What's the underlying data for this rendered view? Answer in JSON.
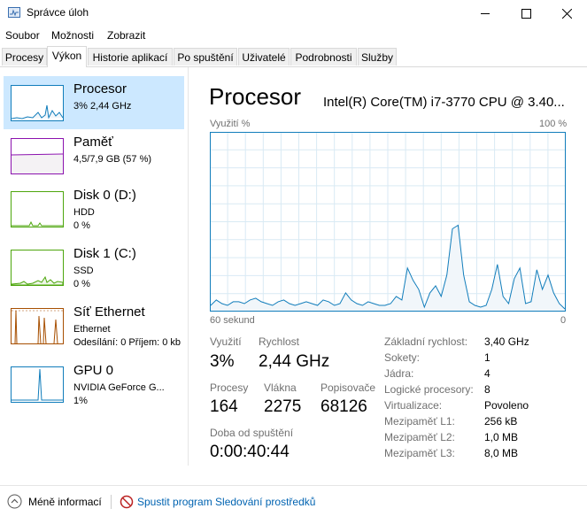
{
  "window": {
    "title": "Správce úloh"
  },
  "menu": {
    "items": [
      "Soubor",
      "Možnosti",
      "Zobrazit"
    ]
  },
  "tabs": [
    "Procesy",
    "Výkon",
    "Historie aplikací",
    "Po spuštění",
    "Uživatelé",
    "Podrobnosti",
    "Služby"
  ],
  "active_tab": "Výkon",
  "sidebar": {
    "items": [
      {
        "title": "Procesor",
        "line1": "3% 2,44 GHz",
        "line2": "",
        "color": "#117dbb"
      },
      {
        "title": "Paměť",
        "line1": "4,5/7,9 GB (57 %)",
        "line2": "",
        "color": "#8b12ae"
      },
      {
        "title": "Disk 0 (D:)",
        "line1": "HDD",
        "line2": "0 %",
        "color": "#4da60c"
      },
      {
        "title": "Disk 1 (C:)",
        "line1": "SSD",
        "line2": "0 %",
        "color": "#4da60c"
      },
      {
        "title": "Síť Ethernet",
        "line1": "Ethernet",
        "line2": "Odesílání: 0 Příjem: 0 kb",
        "color": "#a74f01"
      },
      {
        "title": "GPU 0",
        "line1": "NVIDIA GeForce G...",
        "line2": "1%",
        "color": "#117dbb"
      }
    ]
  },
  "main": {
    "title": "Procesor",
    "cpu_name": "Intel(R) Core(TM) i7-3770 CPU @ 3.40...",
    "graph": {
      "top_left": "Využití %",
      "top_right": "100 %",
      "bottom_left": "60 sekund",
      "bottom_right": "0",
      "accent": "#117dbb",
      "fill": "#f1f6fa",
      "grid": "#d9eaf4",
      "values": [
        3,
        6,
        4,
        3,
        5,
        5,
        4,
        6,
        7,
        5,
        4,
        3,
        5,
        6,
        4,
        3,
        4,
        5,
        4,
        3,
        6,
        5,
        3,
        4,
        10,
        6,
        4,
        3,
        5,
        4,
        3,
        3,
        4,
        8,
        6,
        24,
        17,
        12,
        2,
        10,
        14,
        8,
        20,
        46,
        48,
        20,
        5,
        3,
        2,
        3,
        12,
        26,
        8,
        4,
        18,
        24,
        4,
        5,
        23,
        12,
        20,
        10,
        4,
        1
      ]
    },
    "stats": {
      "usage_label": "Využití",
      "usage": "3%",
      "speed_label": "Rychlost",
      "speed": "2,44 GHz",
      "processes_label": "Procesy",
      "processes": "164",
      "threads_label": "Vlákna",
      "threads": "2275",
      "handles_label": "Popisovače",
      "handles": "68126",
      "uptime_label": "Doba od spuštění",
      "uptime": "0:00:40:44"
    },
    "info": [
      {
        "label": "Základní rychlost:",
        "value": "3,40 GHz"
      },
      {
        "label": "Sokety:",
        "value": "1"
      },
      {
        "label": "Jádra:",
        "value": "4"
      },
      {
        "label": "Logické procesory:",
        "value": "8"
      },
      {
        "label": "Virtualizace:",
        "value": "Povoleno"
      },
      {
        "label": "Mezipaměť L1:",
        "value": "256 kB"
      },
      {
        "label": "Mezipaměť L2:",
        "value": "1,0 MB"
      },
      {
        "label": "Mezipaměť L3:",
        "value": "8,0 MB"
      }
    ]
  },
  "footer": {
    "less_info": "Méně informací",
    "resource_monitor": "Spustit program Sledování prostředků"
  }
}
